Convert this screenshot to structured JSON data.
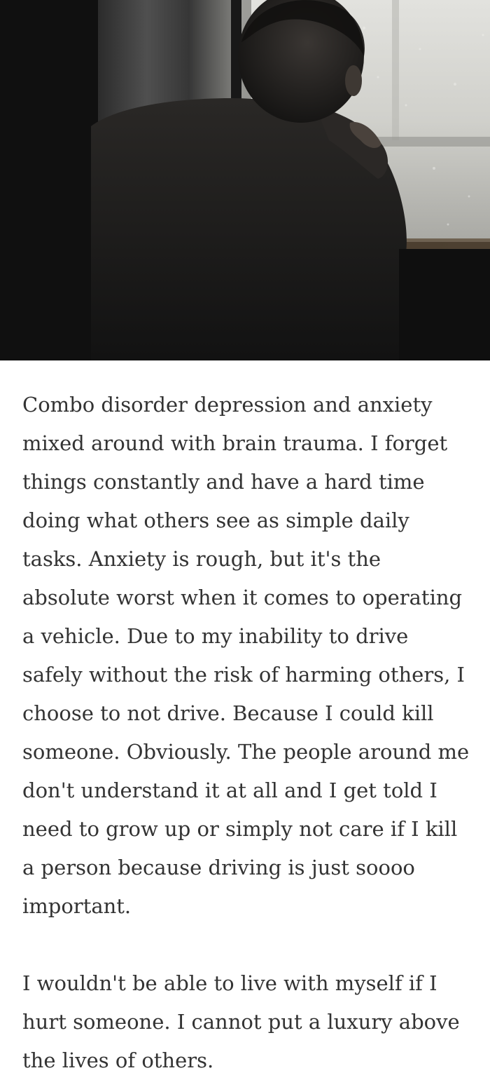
{
  "hero_image": {
    "icon": "photo-person-by-window",
    "description": "person-silhouette-window"
  },
  "article": {
    "paragraphs": [
      "Combo disorder depression and anxiety mixed around with brain trauma. I forget things constantly and have a hard time doing what others see as simple daily tasks. Anxiety is rough, but it's the absolute worst when it comes to operating a vehicle. Due to my inability to drive safely without the risk of harming others, I choose to not drive. Because I could kill someone. Obviously. The people around me don't understand it at all and I get told I need to grow up or simply not care if I kill a person because driving is just soooo important.",
      "I wouldn't be able to live with myself if I hurt someone. I cannot put a luxury above the lives of others."
    ]
  },
  "colors": {
    "text": "#333333",
    "background": "#ffffff",
    "photo_dark": "#141414",
    "window_light": "#d6d6d2"
  }
}
